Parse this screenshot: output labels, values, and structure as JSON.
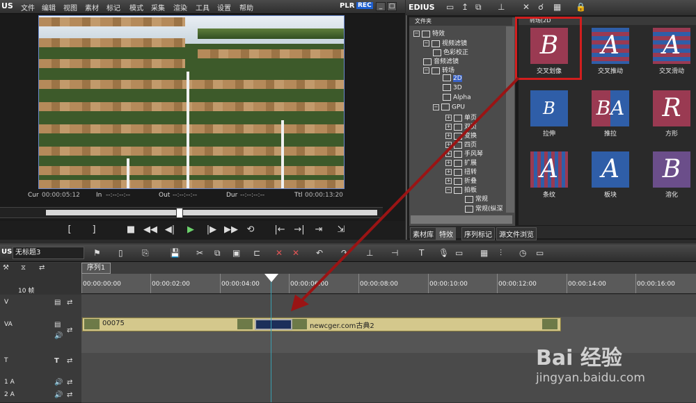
{
  "player": {
    "logo": "US",
    "menu": [
      "文件",
      "编辑",
      "视图",
      "素材",
      "标记",
      "模式",
      "采集",
      "渲染",
      "工具",
      "设置",
      "帮助"
    ],
    "plr": "PLR",
    "rec": "REC",
    "timecodes": {
      "cur_label": "Cur",
      "cur_value": "00:00:05:12",
      "in_label": "In",
      "in_value": "--:--:--:--",
      "out_label": "Out",
      "out_value": "--:--:--:--",
      "dur_label": "Dur",
      "dur_value": "--:--:--:--",
      "ttl_label": "Ttl",
      "ttl_value": "00:00:13:20"
    }
  },
  "effects": {
    "logo": "EDIUS",
    "tree_header": "文件夹",
    "tree": [
      {
        "label": "特效",
        "indent": 0
      },
      {
        "label": "视频滤镜",
        "indent": 1
      },
      {
        "label": "色彩校正",
        "indent": 2
      },
      {
        "label": "音频滤镜",
        "indent": 1
      },
      {
        "label": "转场",
        "indent": 1
      },
      {
        "label": "2D",
        "indent": 2,
        "selected": true
      },
      {
        "label": "3D",
        "indent": 2
      },
      {
        "label": "Alpha",
        "indent": 2
      },
      {
        "label": "GPU",
        "indent": 2
      },
      {
        "label": "单页",
        "indent": 3
      },
      {
        "label": "双页",
        "indent": 3
      },
      {
        "label": "变换",
        "indent": 3
      },
      {
        "label": "四页",
        "indent": 3
      },
      {
        "label": "手风琴",
        "indent": 3
      },
      {
        "label": "扩展",
        "indent": 3
      },
      {
        "label": "扭转",
        "indent": 3
      },
      {
        "label": "折叠",
        "indent": 3
      },
      {
        "label": "拍板",
        "indent": 3
      },
      {
        "label": "常规",
        "indent": 4
      },
      {
        "label": "常规(纵深",
        "indent": 4
      }
    ],
    "grid_header": "转场(2D",
    "items": [
      {
        "label": "交叉划像",
        "glyph": "B",
        "style": "pink"
      },
      {
        "label": "交叉推动",
        "glyph": "A",
        "style": "pink"
      },
      {
        "label": "交叉滑动",
        "glyph": "A",
        "style": "pink"
      },
      {
        "label": "拉伸",
        "glyph": "B",
        "style": "blue"
      },
      {
        "label": "推拉",
        "glyph": "BA",
        "style": "pink"
      },
      {
        "label": "方形",
        "glyph": "R",
        "style": "pink"
      },
      {
        "label": "条纹",
        "glyph": "A",
        "style": "pink"
      },
      {
        "label": "板块",
        "glyph": "A",
        "style": "blue"
      },
      {
        "label": "溶化",
        "glyph": "B",
        "style": "purple"
      }
    ],
    "tabs": [
      "素材库",
      "特效",
      "序列标记",
      "源文件浏览"
    ]
  },
  "timeline": {
    "logo": "US",
    "project": "无标题3",
    "sequence_tab": "序列1",
    "frames_label": "10 帧",
    "tracks": [
      {
        "name": "V"
      },
      {
        "name": "VA"
      },
      {
        "name": "T"
      },
      {
        "name": "1 A"
      },
      {
        "name": "2 A"
      }
    ],
    "ruler": [
      "00:00:00:00",
      "00:00:02:00",
      "00:00:04:00",
      "00:00:06:00",
      "00:00:08:00",
      "00:00:10:00",
      "00:00:12:00",
      "00:00:14:00",
      "00:00:16:00"
    ],
    "clip_a": "00075",
    "clip_b": "newcger.com古典2"
  },
  "watermark": {
    "brand": "Bai 经验",
    "url": "jingyan.baidu.com"
  }
}
